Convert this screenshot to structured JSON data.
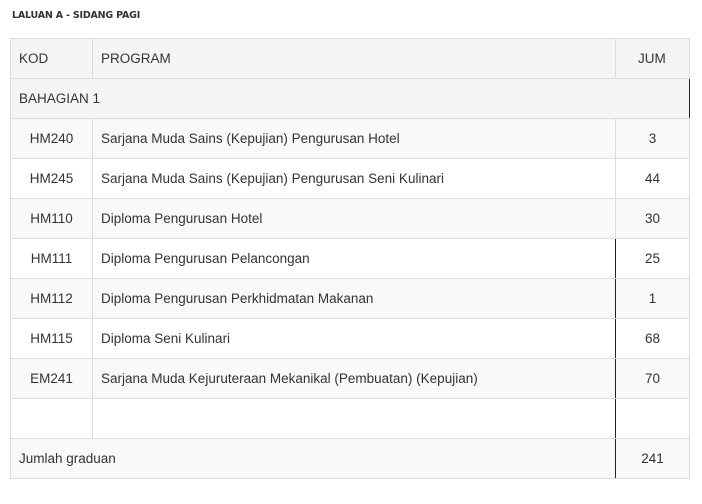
{
  "caption": "LALUAN A - SIDANG PAGI",
  "table": {
    "headers": {
      "kod": "KOD",
      "program": "PROGRAM",
      "jum": "JUM"
    },
    "section_label": "BAHAGIAN 1",
    "rows": [
      {
        "kod": "HM240",
        "program": "Sarjana Muda Sains (Kepujian) Pengurusan Hotel",
        "jum": "3"
      },
      {
        "kod": "HM245",
        "program": "Sarjana Muda Sains (Kepujian) Pengurusan Seni Kulinari",
        "jum": "44"
      },
      {
        "kod": "HM110",
        "program": "Diploma Pengurusan Hotel",
        "jum": "30"
      },
      {
        "kod": "HM111",
        "program": "Diploma Pengurusan Pelancongan",
        "jum": "25"
      },
      {
        "kod": "HM112",
        "program": "Diploma Pengurusan Perkhidmatan Makanan",
        "jum": "1"
      },
      {
        "kod": "HM115",
        "program": "Diploma Seni Kulinari",
        "jum": "68"
      },
      {
        "kod": "EM241",
        "program": "Sarjana Muda Kejuruteraan Mekanikal (Pembuatan) (Kepujian)",
        "jum": "70"
      },
      {
        "kod": "",
        "program": "",
        "jum": ""
      }
    ],
    "total": {
      "label": "Jumlah graduan",
      "value": "241"
    }
  }
}
